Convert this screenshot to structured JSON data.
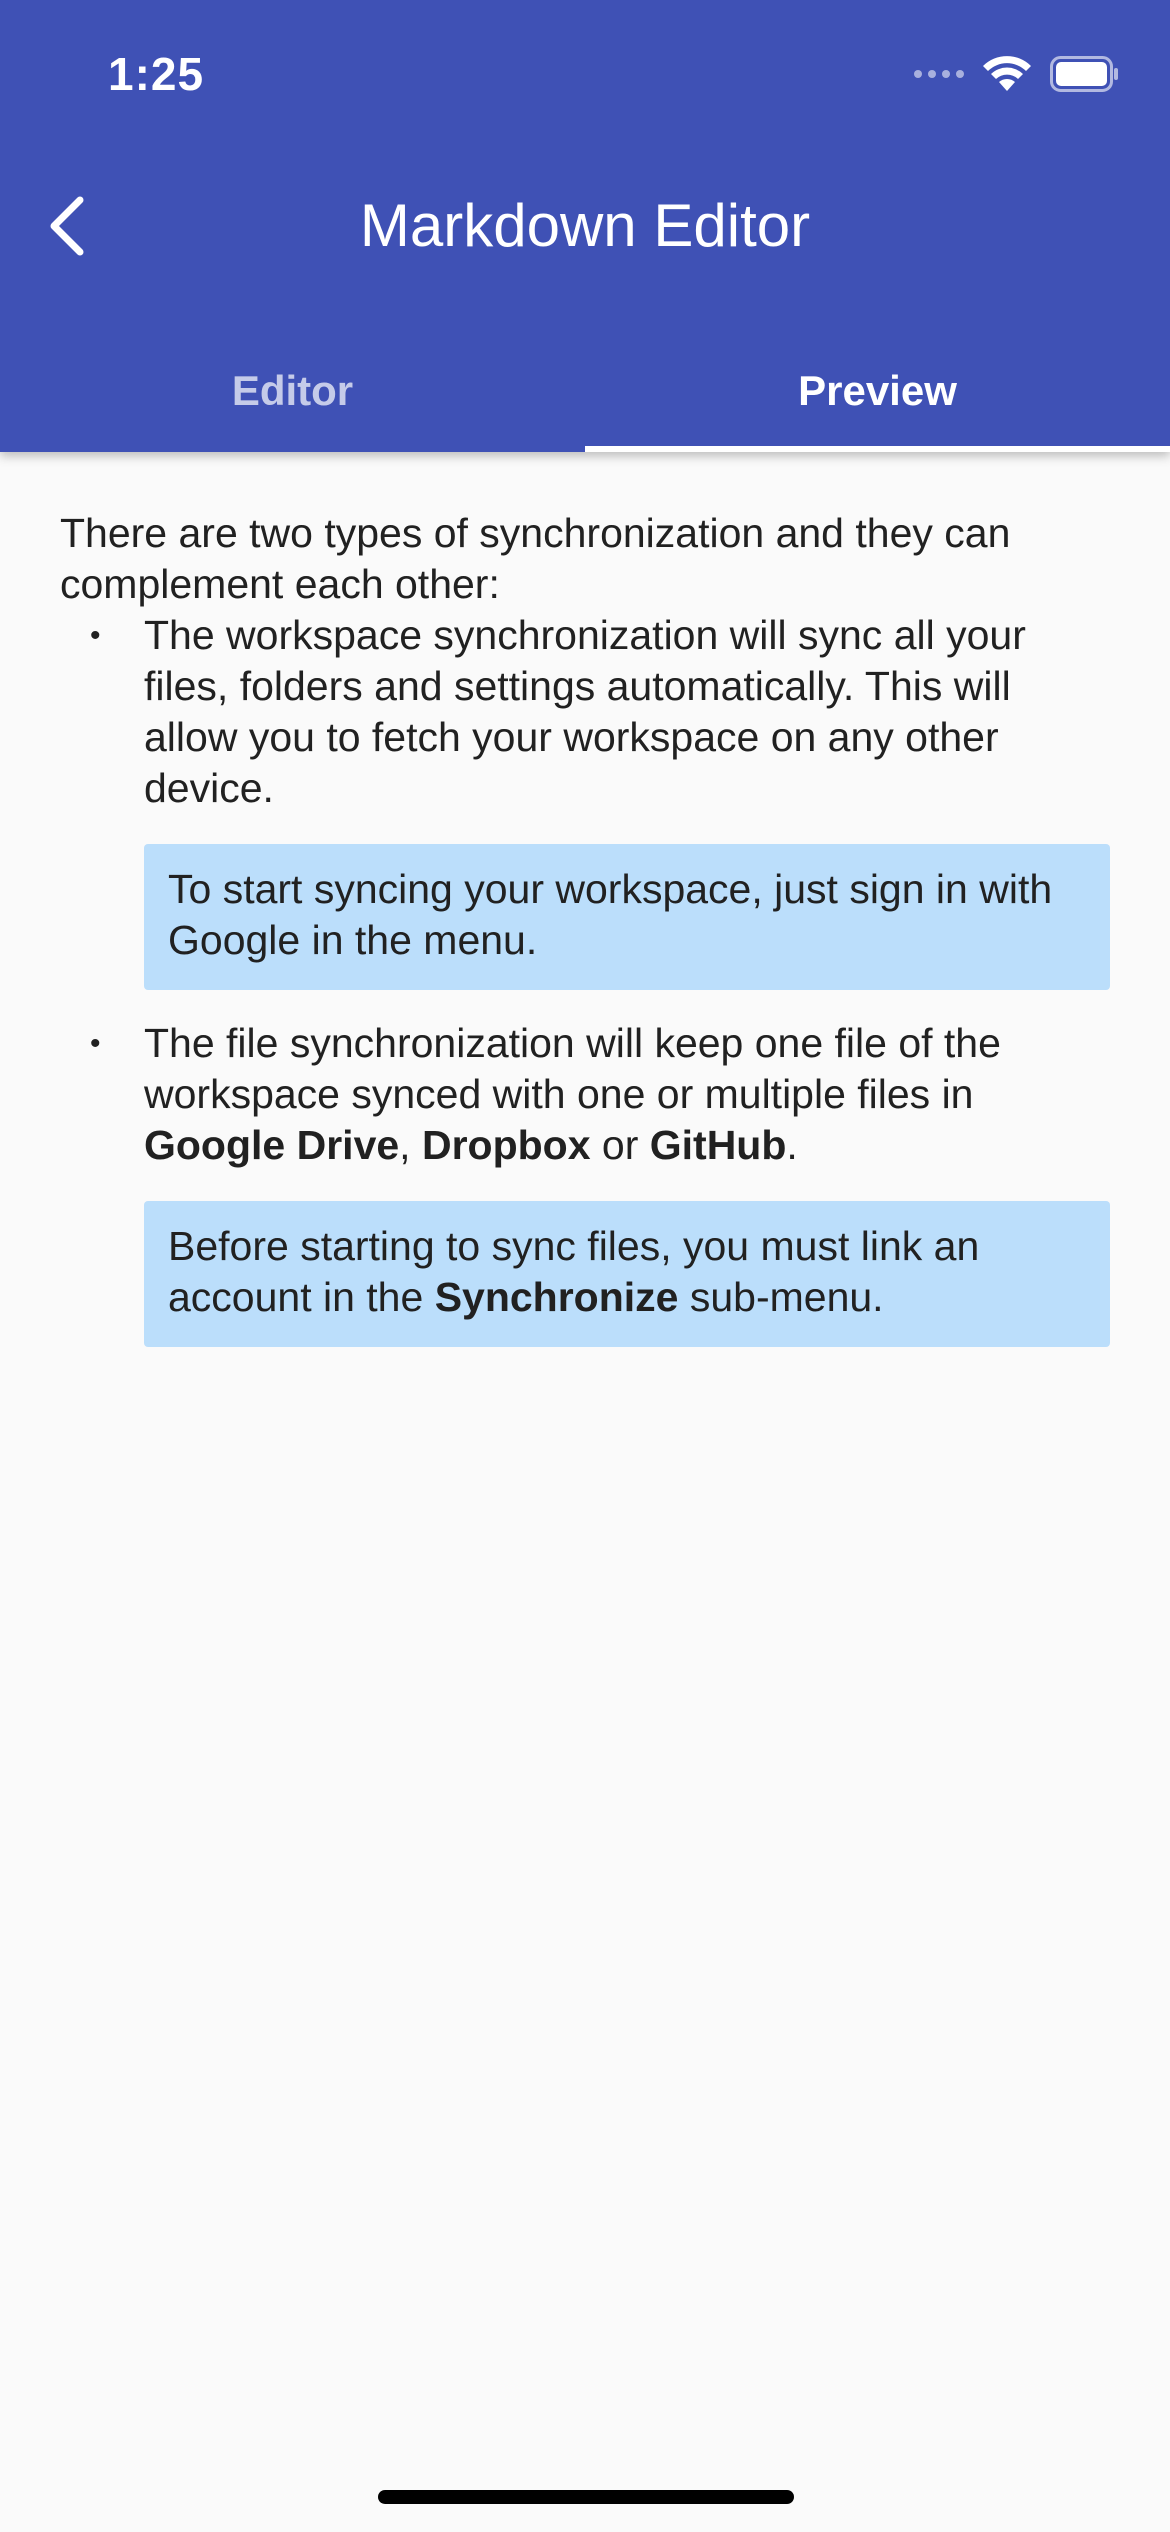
{
  "status_bar": {
    "time": "1:25"
  },
  "app_bar": {
    "title": "Markdown Editor",
    "back_icon": "chevron-left-icon"
  },
  "tabs": [
    {
      "label": "Editor",
      "selected": false
    },
    {
      "label": "Preview",
      "selected": true
    }
  ],
  "preview": {
    "intro": "There are two types of synchronization and they can complement each other:",
    "items": [
      {
        "text": "The workspace synchronization will sync all your files, folders and settings automatically. This will allow you to fetch your workspace on any other device.",
        "note": "To start syncing your workspace, just sign in with Google in the menu."
      },
      {
        "text_before": "The file synchronization will keep one file of the workspace synced with one or multiple files in ",
        "bold_1": "Google Drive",
        "sep_1": ", ",
        "bold_2": "Dropbox",
        "sep_2": " or ",
        "bold_3": "GitHub",
        "text_after": ".",
        "note_before": "Before starting to sync files, you must link an account in the ",
        "note_bold": "Synchronize",
        "note_after": " sub-menu."
      }
    ],
    "bullet": "•"
  },
  "colors": {
    "primary": "#3f51b5",
    "note_background": "#bbdefb",
    "background": "#fafafa"
  }
}
